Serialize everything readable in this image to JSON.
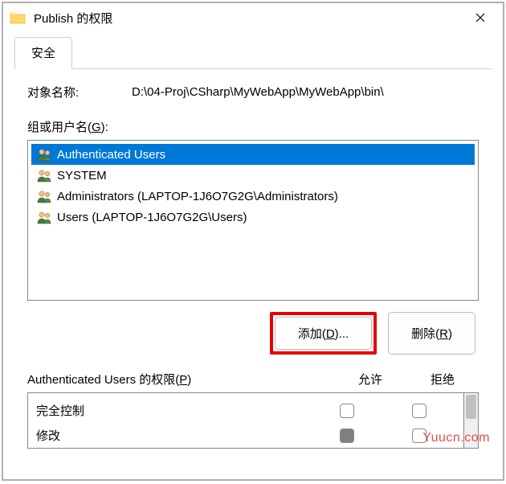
{
  "window": {
    "title": "Publish 的权限",
    "tab_security": "安全"
  },
  "object": {
    "label": "对象名称:",
    "value": "D:\\04-Proj\\CSharp\\MyWebApp\\MyWebApp\\bin\\"
  },
  "groups": {
    "label_prefix": "组或用户名(",
    "label_u": "G",
    "label_suffix": "):",
    "items": [
      {
        "name": "Authenticated Users",
        "selected": true,
        "icon": "group"
      },
      {
        "name": "SYSTEM",
        "selected": false,
        "icon": "group"
      },
      {
        "name": "Administrators (LAPTOP-1J6O7G2G\\Administrators)",
        "selected": false,
        "icon": "group"
      },
      {
        "name": "Users (LAPTOP-1J6O7G2G\\Users)",
        "selected": false,
        "icon": "group"
      }
    ]
  },
  "buttons": {
    "add_prefix": "添加(",
    "add_u": "D",
    "add_suffix": ")...",
    "remove_prefix": "删除(",
    "remove_u": "R",
    "remove_suffix": ")"
  },
  "permissions": {
    "label_prefix": "Authenticated Users 的权限(",
    "label_u": "P",
    "label_suffix": ")",
    "col_allow": "允许",
    "col_deny": "拒绝",
    "rows": [
      {
        "label": "完全控制",
        "allow": false,
        "deny": false
      },
      {
        "label": "修改",
        "allow": true,
        "deny": false
      }
    ]
  },
  "watermark": "Yuucn.com"
}
